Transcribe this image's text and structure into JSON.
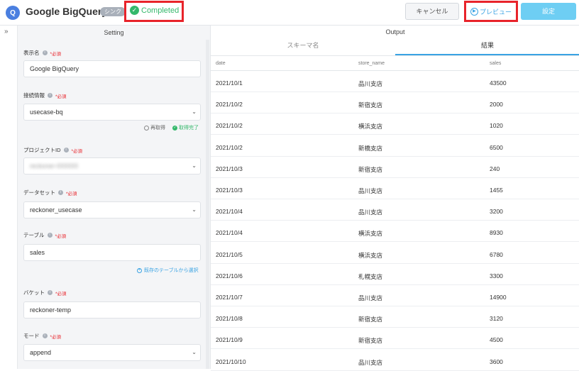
{
  "header": {
    "logo_text": "Q",
    "app_title": "Google BigQuery",
    "badge": "シンク",
    "status": "Completed",
    "cancel_label": "キャンセル",
    "preview_label": "プレビュー",
    "setting_label": "設定",
    "colors": {
      "status_green": "#34b86b",
      "accent_blue": "#3aa3e3",
      "setting_bg": "#6ecef3",
      "highlight_red": "#e8232a"
    }
  },
  "setting": {
    "title": "Setting",
    "required": "*必須",
    "display_name": {
      "label": "表示名",
      "value": "Google BigQuery"
    },
    "connection": {
      "label": "接続情報",
      "value": "usecase-bq",
      "refetch": "再取得",
      "fetched": "取得完了"
    },
    "project": {
      "label": "プロジェクトID",
      "value": "reckoner-000000"
    },
    "dataset": {
      "label": "データセット",
      "value": "reckoner_usecase"
    },
    "table": {
      "label": "テーブル",
      "value": "sales",
      "choose_existing": "既存のテーブルから選択"
    },
    "bucket": {
      "label": "バケット",
      "value": "reckoner-temp"
    },
    "mode": {
      "label": "モード",
      "value": "append"
    }
  },
  "output": {
    "title": "Output",
    "tabs": [
      "スキーマ名",
      "結果"
    ],
    "columns": [
      "date",
      "store_name",
      "sales"
    ],
    "rows": [
      [
        "2021/10/1",
        "品川支店",
        "43500"
      ],
      [
        "2021/10/2",
        "新宿支店",
        "2000"
      ],
      [
        "2021/10/2",
        "横浜支店",
        "1020"
      ],
      [
        "2021/10/2",
        "新橋支店",
        "6500"
      ],
      [
        "2021/10/3",
        "新宿支店",
        "240"
      ],
      [
        "2021/10/3",
        "品川支店",
        "1455"
      ],
      [
        "2021/10/4",
        "品川支店",
        "3200"
      ],
      [
        "2021/10/4",
        "横浜支店",
        "8930"
      ],
      [
        "2021/10/5",
        "横浜支店",
        "6780"
      ],
      [
        "2021/10/6",
        "札幌支店",
        "3300"
      ],
      [
        "2021/10/7",
        "品川支店",
        "14900"
      ],
      [
        "2021/10/8",
        "新宿支店",
        "3120"
      ],
      [
        "2021/10/9",
        "新宿支店",
        "4500"
      ],
      [
        "2021/10/10",
        "品川支店",
        "3600"
      ]
    ]
  }
}
